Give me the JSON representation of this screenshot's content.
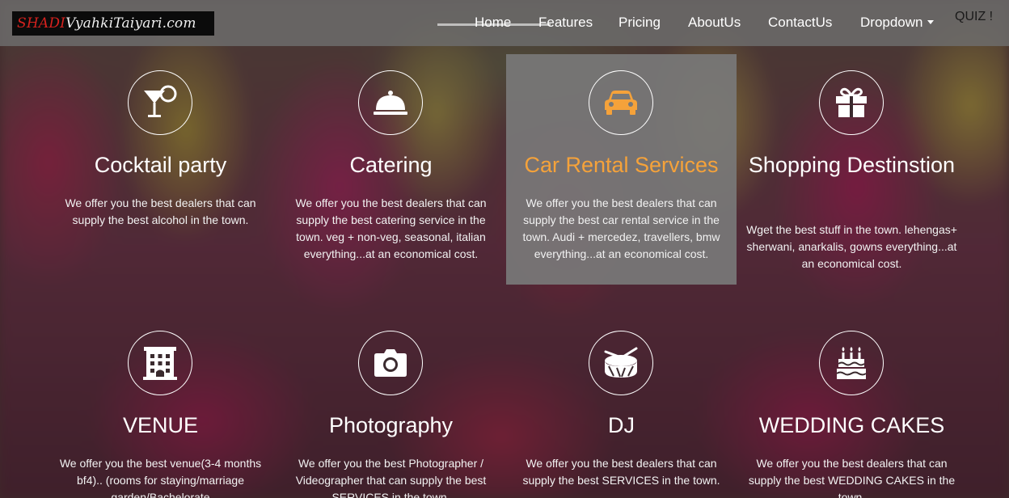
{
  "brand": {
    "part1": "SHADI",
    "part2": "VyahkiTaiyari.com"
  },
  "nav": {
    "links": [
      "Home",
      "Features",
      "Pricing",
      "AboutUs",
      "ContactUs",
      "Dropdown"
    ],
    "quiz": "QUIZ !"
  },
  "services": [
    {
      "title": "Cocktail party",
      "icon": "cocktail-icon",
      "description": "We offer you the best dealers that can supply the best alcohol in the town."
    },
    {
      "title": "Catering",
      "icon": "cloche-icon",
      "description": "We offer you the best dealers that can supply the best catering service in the town. veg + non-veg, seasonal, italian everything...at an economical cost."
    },
    {
      "title": "Car Rental Services",
      "icon": "car-icon",
      "description": "We offer you the best dealers that can supply the best car rental service in the town. Audi + mercedez, travellers, bmw everything...at an economical cost."
    },
    {
      "title": "Shopping Destinstion",
      "icon": "gift-icon",
      "description": "Wget the best stuff in the town. lehengas+ sherwani, anarkalis, gowns everything...at an economical cost."
    },
    {
      "title": "VENUE",
      "icon": "building-icon",
      "description": "We offer you the best venue(3-4 months bf4).. (rooms for staying/marriage garden/Bachelorate"
    },
    {
      "title": "Photography",
      "icon": "camera-icon",
      "description": "We offer you the best Photographer / Videographer that can supply the best SERVICES in the town."
    },
    {
      "title": "DJ",
      "icon": "drum-icon",
      "description": "We offer you the best dealers that can supply the best SERVICES in the town."
    },
    {
      "title": "WEDDING CAKES",
      "icon": "cake-icon",
      "description": "We offer you the best dealers that can supply the best WEDDING CAKES in the town."
    }
  ],
  "colors": {
    "accent": "#f5a23a",
    "navbar": "#6e6e6e",
    "active_card": "#787878"
  }
}
